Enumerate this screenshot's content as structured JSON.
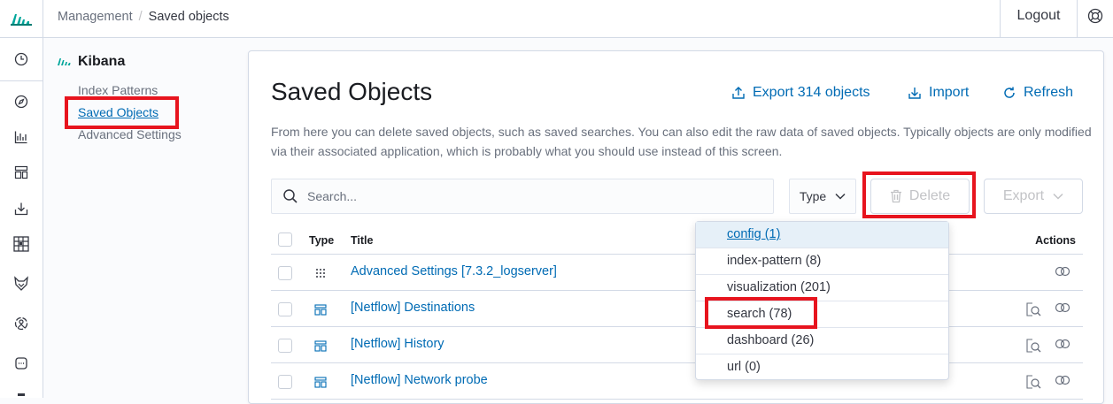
{
  "topbar": {
    "breadcrumb_parent": "Management",
    "breadcrumb_current": "Saved objects",
    "logout_label": "Logout"
  },
  "sidebar": {
    "heading": "Kibana",
    "links": [
      "Index Patterns",
      "Saved Objects",
      "Advanced Settings"
    ]
  },
  "page": {
    "title": "Saved Objects",
    "export_all_label": "Export 314 objects",
    "import_label": "Import",
    "refresh_label": "Refresh",
    "description": "From here you can delete saved objects, such as saved searches. You can also edit the raw data of saved objects. Typically objects are only modified via their associated application, which is probably what you should use instead of this screen."
  },
  "toolbar": {
    "search_placeholder": "Search...",
    "type_label": "Type",
    "delete_label": "Delete",
    "export_label": "Export"
  },
  "table": {
    "headers": {
      "type": "Type",
      "title": "Title",
      "actions": "Actions"
    },
    "rows": [
      {
        "title": "Advanced Settings [7.3.2_logserver]",
        "icon": "settings-grid-icon"
      },
      {
        "title": "[Netflow] Destinations",
        "icon": "dashboard-icon"
      },
      {
        "title": "[Netflow] History",
        "icon": "dashboard-icon"
      },
      {
        "title": "[Netflow] Network probe",
        "icon": "dashboard-icon"
      }
    ]
  },
  "type_filter": {
    "options": [
      "config (1)",
      "index-pattern (8)",
      "visualization (201)",
      "search (78)",
      "dashboard (26)",
      "url (0)"
    ]
  },
  "colors": {
    "link": "#006bb4",
    "highlight": "#e7141e",
    "kibana_green": "#00a69b"
  }
}
